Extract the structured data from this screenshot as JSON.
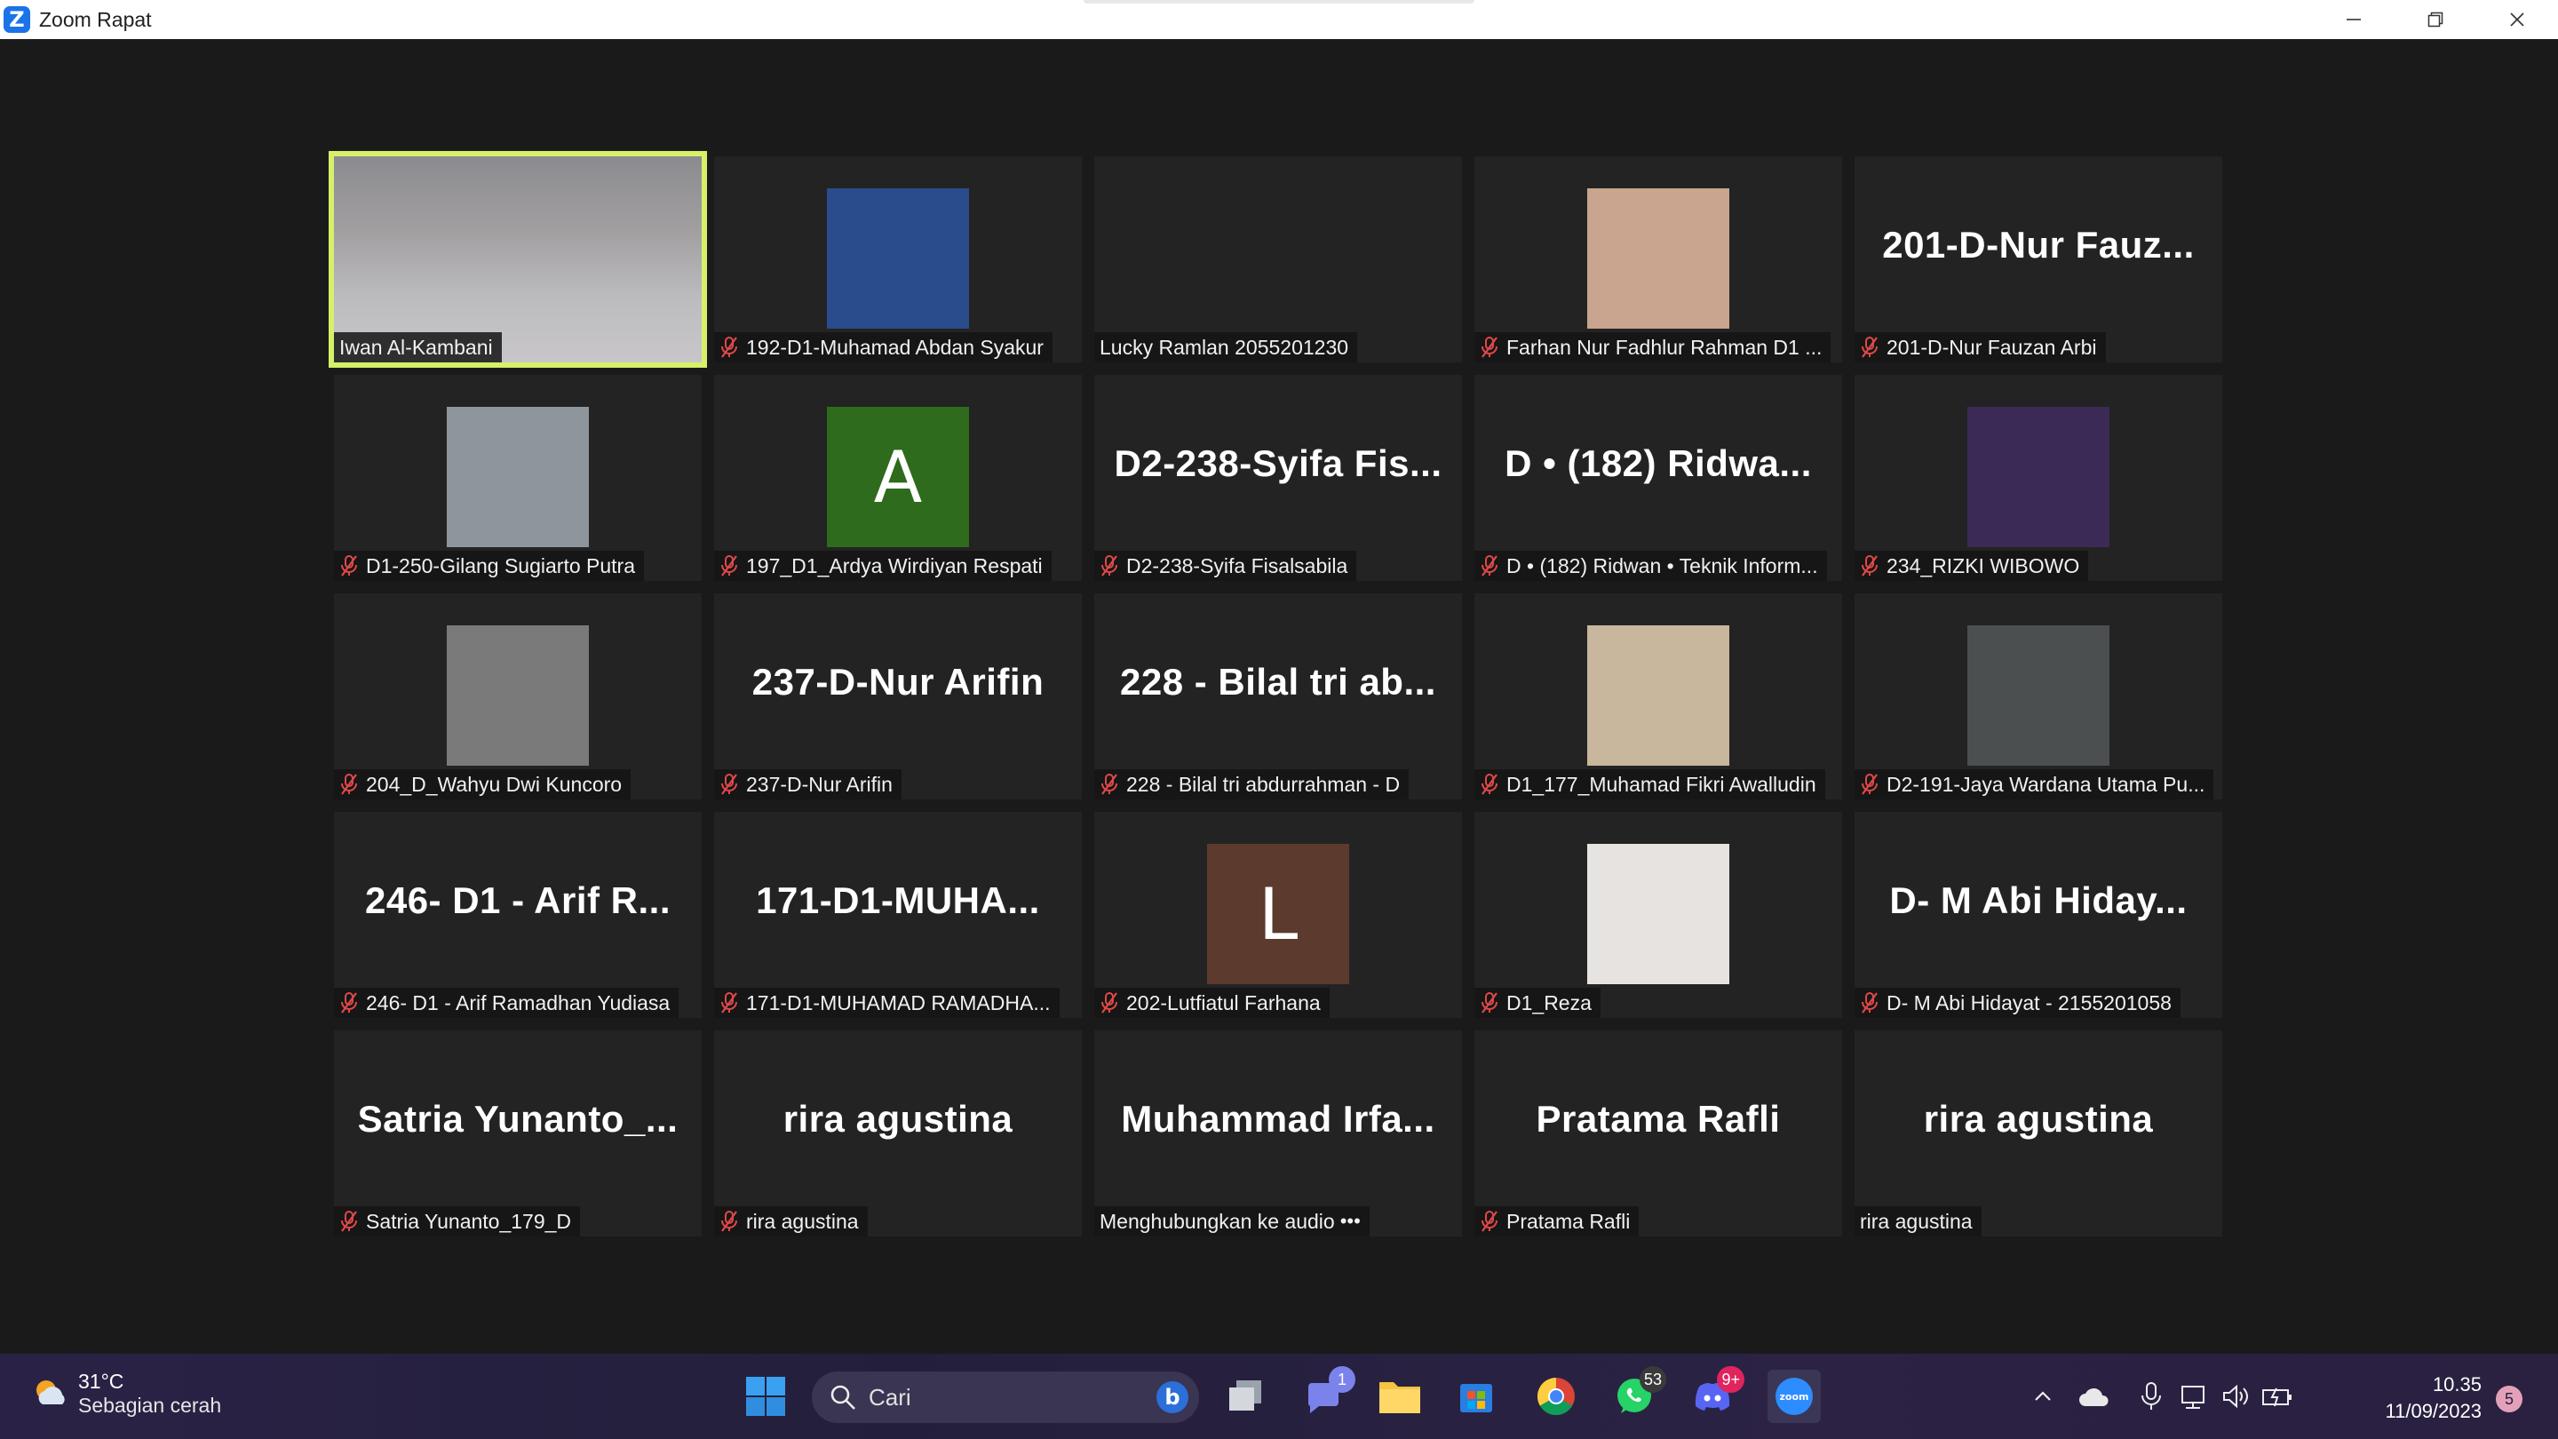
{
  "window": {
    "title": "Zoom Rapat",
    "logo_letter": "Z",
    "minimize_icon": "minimize-icon",
    "restore_icon": "restore-icon",
    "close_icon": "close-icon"
  },
  "participants": [
    {
      "label": "Iwan Al-Kambani",
      "big": "",
      "muted": false,
      "kind": "video"
    },
    {
      "label": "192-D1-Muhamad Abdan Syakur",
      "big": "",
      "muted": true,
      "kind": "photo",
      "color": "#2a4c8c"
    },
    {
      "label": "Lucky Ramlan 2055201230",
      "big": "",
      "muted": false,
      "kind": "blank"
    },
    {
      "label": "Farhan Nur Fadhlur Rahman D1 ...",
      "big": "",
      "muted": true,
      "kind": "photo",
      "color": "#c9a48e"
    },
    {
      "label": "201-D-Nur Fauzan Arbi",
      "big": "201-D-Nur  Fauz...",
      "muted": true,
      "kind": "name"
    },
    {
      "label": "D1-250-Gilang Sugiarto Putra",
      "big": "",
      "muted": true,
      "kind": "photo",
      "color": "#8e969c"
    },
    {
      "label": "197_D1_Ardya Wirdiyan Respati",
      "big": "A",
      "muted": true,
      "kind": "letter",
      "color": "#2e6b1c"
    },
    {
      "label": "D2-238-Syifa Fisalsabila",
      "big": "D2-238-Syifa  Fis...",
      "muted": true,
      "kind": "name"
    },
    {
      "label": "D • (182) Ridwan • Teknik Inform...",
      "big": "D • (182)  Ridwa...",
      "muted": true,
      "kind": "name"
    },
    {
      "label": "234_RIZKI WIBOWO",
      "big": "",
      "muted": true,
      "kind": "photo",
      "color": "#3b2a55"
    },
    {
      "label": "204_D_Wahyu Dwi Kuncoro",
      "big": "",
      "muted": true,
      "kind": "photo",
      "color": "#7a7a7a"
    },
    {
      "label": "237-D-Nur Arifin",
      "big": "237-D-Nur Arifin",
      "muted": true,
      "kind": "name"
    },
    {
      "label": "228 - Bilal tri abdurrahman - D",
      "big": "228  -  Bilal  tri  ab...",
      "muted": true,
      "kind": "name"
    },
    {
      "label": "D1_177_Muhamad Fikri Awalludin",
      "big": "",
      "muted": true,
      "kind": "photo",
      "color": "#c8b79c"
    },
    {
      "label": "D2-191-Jaya Wardana Utama Pu...",
      "big": "",
      "muted": true,
      "kind": "photo",
      "color": "#4b4f50"
    },
    {
      "label": "246- D1 - Arif Ramadhan Yudiasa",
      "big": "246-  D1  -  Arif  R...",
      "muted": true,
      "kind": "name"
    },
    {
      "label": "171-D1-MUHAMAD RAMADHA...",
      "big": "171-D1-MUHA...",
      "muted": true,
      "kind": "name"
    },
    {
      "label": "202-Lutfiatul Farhana",
      "big": "L",
      "muted": true,
      "kind": "letter",
      "color": "#5c3a2e"
    },
    {
      "label": "D1_Reza",
      "big": "",
      "muted": true,
      "kind": "photo",
      "color": "#e7e3e1"
    },
    {
      "label": "D- M Abi Hidayat - 2155201058",
      "big": "D-  M  Abi  Hiday...",
      "muted": true,
      "kind": "name"
    },
    {
      "label": "Satria Yunanto_179_D",
      "big": "Satria  Yunanto_...",
      "muted": true,
      "kind": "name"
    },
    {
      "label": "rira agustina",
      "big": "rira agustina",
      "muted": true,
      "kind": "name"
    },
    {
      "label": "Menghubungkan ke audio",
      "big": "Muhammad  Irfa...",
      "muted": false,
      "kind": "name",
      "connecting": true
    },
    {
      "label": "Pratama Rafli",
      "big": "Pratama Rafli",
      "muted": true,
      "kind": "name"
    },
    {
      "label": "rira agustina",
      "big": "rira agustina",
      "muted": false,
      "kind": "name"
    }
  ],
  "taskbar": {
    "weather_temp": "31°C",
    "weather_cond": "Sebagian cerah",
    "search_placeholder": "Cari",
    "teams_badge": "1",
    "whatsapp_badge": "53",
    "discord_badge": "9+",
    "clock_time": "10.35",
    "clock_date": "11/09/2023",
    "notification_count": "5",
    "colors": {
      "accent": "#1a73e8",
      "active_speaker": "#d6f06a",
      "muted_mic": "#e04848"
    }
  }
}
